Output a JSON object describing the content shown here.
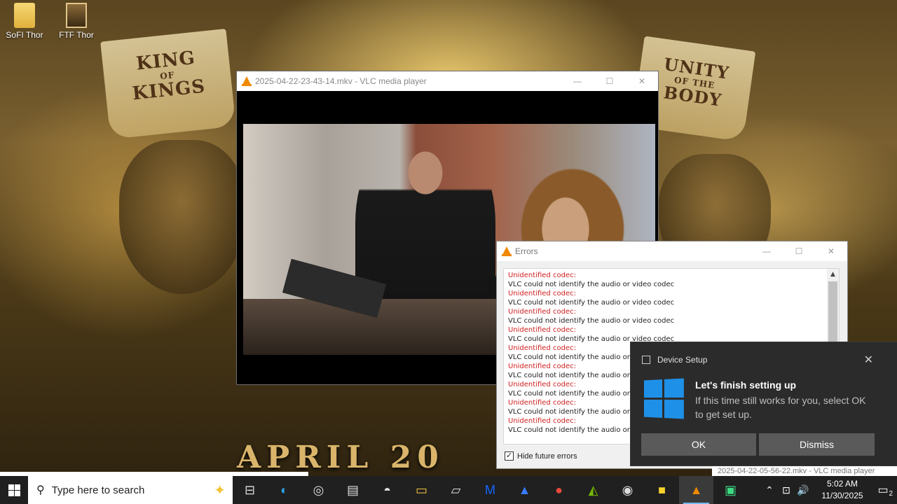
{
  "desktop": {
    "icons": [
      {
        "label": "SoFI Thor"
      },
      {
        "label": "FTF Thor"
      }
    ],
    "wallpaper": {
      "banner_left_top": "KING",
      "banner_left_mid": "OF",
      "banner_left_bottom": "KINGS",
      "banner_right_top": "UNITY",
      "banner_right_mid": "OF THE",
      "banner_right_bottom": "BODY",
      "bottom_text": "APRIL 20"
    }
  },
  "vlc_window": {
    "title": "2025-04-22-23-43-14.mkv - VLC media player",
    "minimize_label": "—",
    "maximize_label": "☐",
    "close_label": "✕"
  },
  "errors_window": {
    "title": "Errors",
    "minimize_label": "—",
    "maximize_label": "☐",
    "close_label": "✕",
    "entries": [
      {
        "head": "Unidentified codec:",
        "msg": "VLC could not identify the audio or video codec"
      },
      {
        "head": "Unidentified codec:",
        "msg": "VLC could not identify the audio or video codec"
      },
      {
        "head": "Unidentified codec:",
        "msg": "VLC could not identify the audio or video codec"
      },
      {
        "head": "Unidentified codec:",
        "msg": "VLC could not identify the audio or video codec"
      },
      {
        "head": "Unidentified codec:",
        "msg": "VLC could not identify the audio or video codec"
      },
      {
        "head": "Unidentified codec:",
        "msg": "VLC could not identify the audio or video codec"
      },
      {
        "head": "Unidentified codec:",
        "msg": "VLC could not identify the audio or video codec"
      },
      {
        "head": "Unidentified codec:",
        "msg": "VLC could not identify the audio or video codec"
      },
      {
        "head": "Unidentified codec:",
        "msg": "VLC could not identify the audio or video codec"
      }
    ],
    "hide_future_errors_label": "Hide future errors",
    "hide_future_errors_checked": true,
    "checkmark": "✓",
    "scroll_up_label": "▲"
  },
  "toast": {
    "app_name": "Device Setup",
    "close_label": "✕",
    "title": "Let's finish setting up",
    "body": "If this time still works for you, select OK to get set up.",
    "ok_label": "OK",
    "dismiss_label": "Dismiss"
  },
  "background_window_tab": "2025-04-22-05-56-22.mkv - VLC media player",
  "taskbar": {
    "search_placeholder": "Type here to search",
    "search_glyph": "⚲",
    "sparkle_glyph": "✦",
    "apps": [
      {
        "name": "task-view",
        "glyph": "⊟"
      },
      {
        "name": "edge",
        "glyph": "◐"
      },
      {
        "name": "app-circle",
        "glyph": "◎"
      },
      {
        "name": "app-cards",
        "glyph": "▤"
      },
      {
        "name": "app-paint",
        "glyph": "◓"
      },
      {
        "name": "file-explorer",
        "glyph": "▭"
      },
      {
        "name": "app-note",
        "glyph": "▱"
      },
      {
        "name": "malwarebytes",
        "glyph": "M"
      },
      {
        "name": "app-arrow",
        "glyph": "▲"
      },
      {
        "name": "chrome",
        "glyph": "●"
      },
      {
        "name": "nvidia",
        "glyph": "◭"
      },
      {
        "name": "obs",
        "glyph": "◉"
      },
      {
        "name": "sticky-notes",
        "glyph": "■"
      },
      {
        "name": "vlc",
        "glyph": "▲"
      },
      {
        "name": "app-green",
        "glyph": "▣"
      }
    ],
    "tray": {
      "chevron": "⌃",
      "network": "⊡",
      "volume": "🔊",
      "time": "5:02 AM",
      "date": "11/30/2025",
      "notifications_glyph": "▭",
      "notifications_count": "2"
    }
  }
}
